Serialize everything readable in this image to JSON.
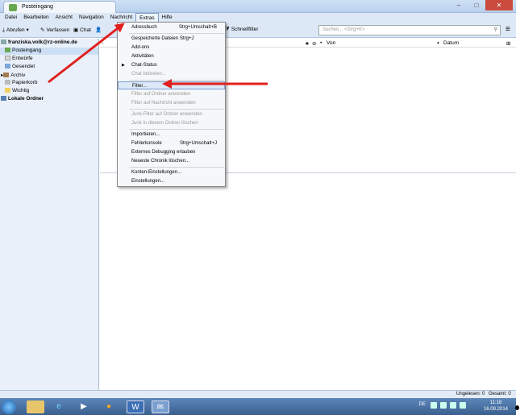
{
  "tab": {
    "title": "Posteingang"
  },
  "window_controls": {
    "minimize": "–",
    "maximize": "□",
    "close": "✕"
  },
  "menubar": [
    "Datei",
    "Bearbeiten",
    "Ansicht",
    "Navigation",
    "Nachricht",
    "Extras",
    "Hilfe"
  ],
  "toolbar": {
    "get": "Abrufen",
    "write": "Verfassen",
    "chat": "Chat",
    "quickfilter": "Schnellfilter",
    "search_placeholder": "Suchen... <Strg+K>"
  },
  "folders": {
    "account": "franziska.volk@rz-online.de",
    "items": [
      "Posteingang",
      "Entwürfe",
      "Gesendet",
      "Archiv",
      "Papierkorb",
      "Wichtig"
    ],
    "local": "Lokale Ordner"
  },
  "columns": {
    "from": "Von",
    "date": "Datum"
  },
  "menu": {
    "addressbook": "Adressbuch",
    "addressbook_sc": "Strg+Umschalt+B",
    "saved_files": "Gespeicherte Dateien",
    "saved_files_sc": "Strg+J",
    "addons": "Add-ons",
    "activities": "Aktivitäten",
    "chat_status": "Chat-Status",
    "chat_edit": "Chat beitreten...",
    "filter": "Filter...",
    "filter_folder": "Filter auf Ordner anwenden",
    "filter_message": "Filter auf Nachricht anwenden",
    "junk_folder": "Junk-Filter auf Ordner anwenden",
    "junk_delete": "Junk in diesem Ordner löschen",
    "import": "Importieren...",
    "console": "Fehlerkonsole",
    "console_sc": "Strg+Umschalt+J",
    "debugging": "Externes Debugging erlauben",
    "clear_history": "Neueste Chronik löschen...",
    "account_settings": "Konten-Einstellungen...",
    "settings": "Einstellungen..."
  },
  "status": {
    "unread": "Ungelesen: 0",
    "total": "Gesamt: 0"
  },
  "taskbar": {
    "lang": "DE",
    "time": "11:18",
    "date": "16.09.2014"
  },
  "colors": {
    "arrow": "#e0201e",
    "accent": "#cddff5"
  }
}
